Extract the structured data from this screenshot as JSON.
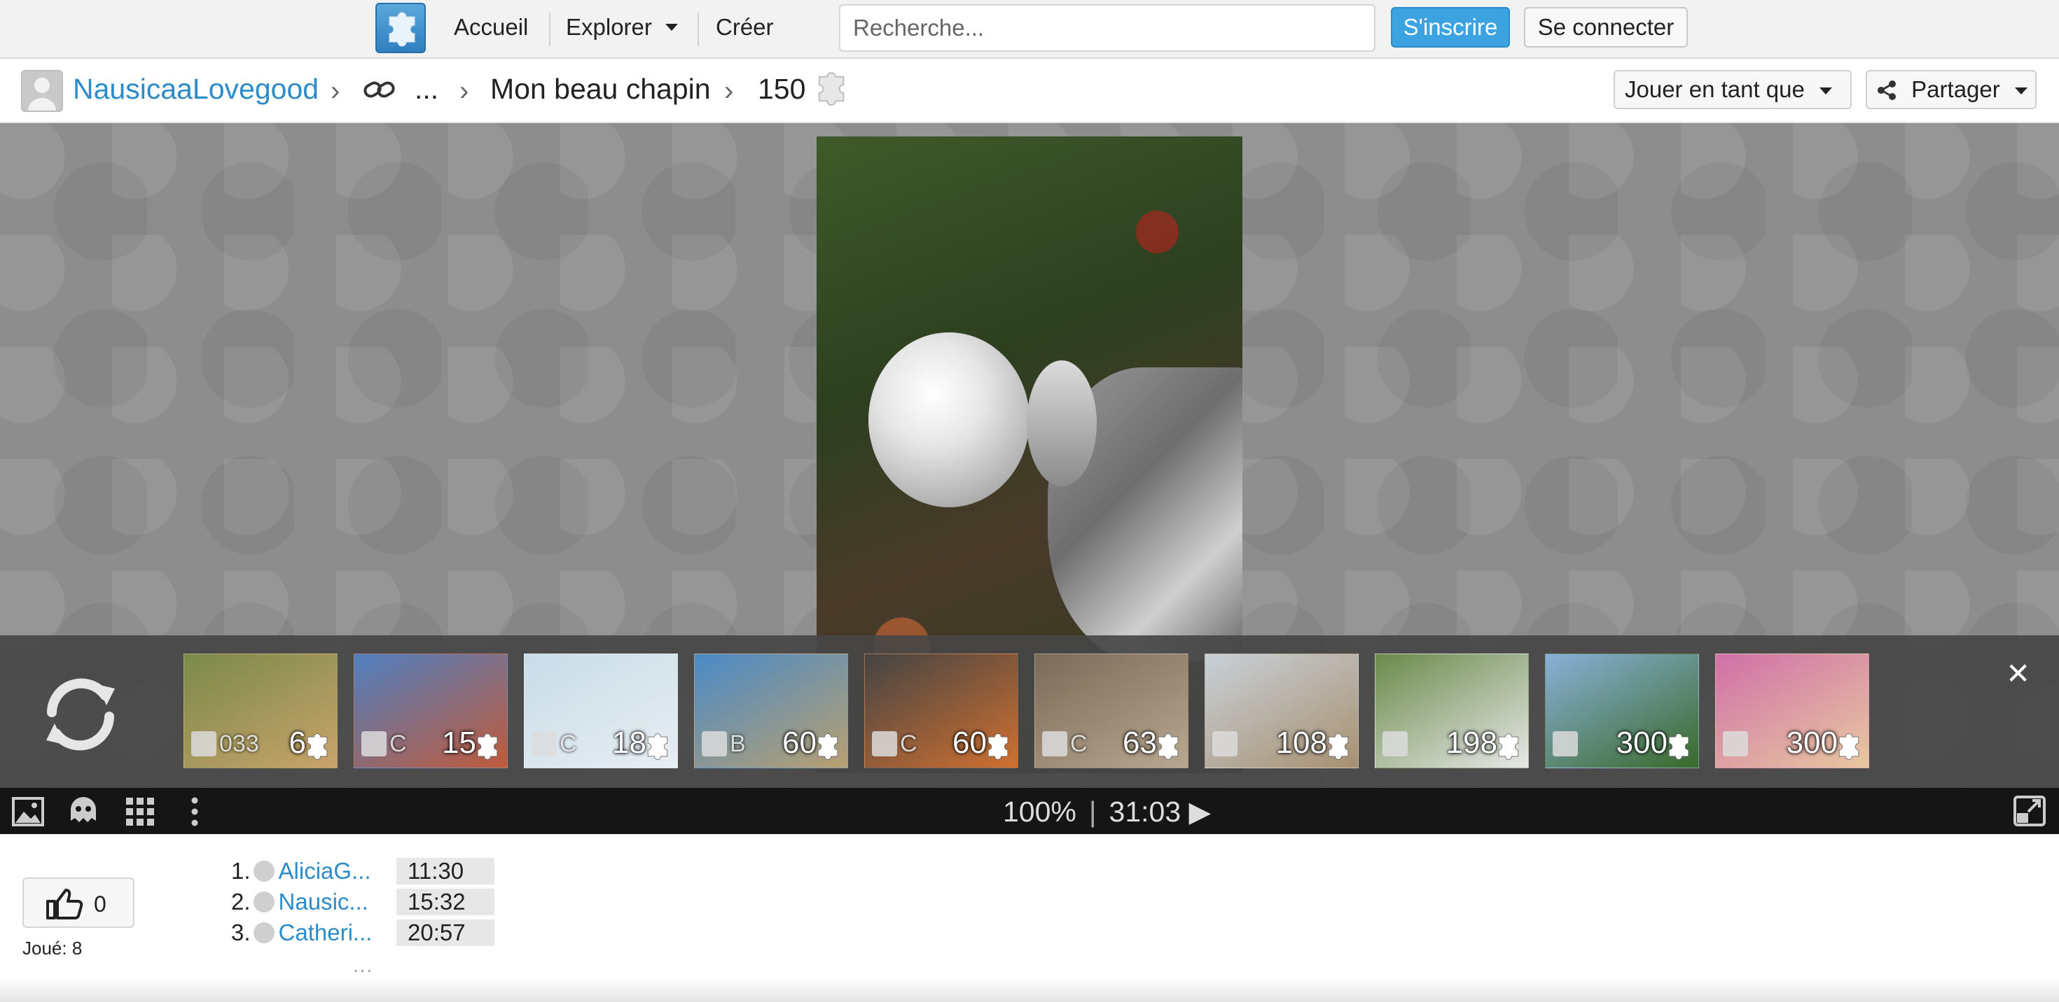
{
  "header": {
    "nav": {
      "home": "Accueil",
      "explore": "Explorer",
      "create": "Créer"
    },
    "search": {
      "placeholder": "Recherche..."
    },
    "signup": "S'inscrire",
    "signin": "Se connecter"
  },
  "breadcrumb": {
    "user": "NausicaaLovegood",
    "ellipsis": "...",
    "album": "Mon beau chapin",
    "pieces": "150"
  },
  "actions": {
    "play_as": "Jouer en tant que",
    "share": "Partager"
  },
  "strip": {
    "thumbs": [
      {
        "count": "6",
        "overlay": "033",
        "colors": [
          "#7a8a4a",
          "#c9a36a"
        ]
      },
      {
        "count": "15",
        "overlay": "C",
        "colors": [
          "#4f7fc0",
          "#c05a3a"
        ]
      },
      {
        "count": "18",
        "overlay": "C",
        "colors": [
          "#c8dce8",
          "#e8eef2"
        ]
      },
      {
        "count": "60",
        "overlay": "B",
        "colors": [
          "#4a8ac8",
          "#b8a070"
        ]
      },
      {
        "count": "60",
        "overlay": "C",
        "colors": [
          "#444444",
          "#d07030"
        ]
      },
      {
        "count": "63",
        "overlay": "C",
        "colors": [
          "#7a6a58",
          "#b8a890"
        ]
      },
      {
        "count": "108",
        "overlay": "",
        "colors": [
          "#c8d0d8",
          "#a89070"
        ]
      },
      {
        "count": "198",
        "overlay": "",
        "colors": [
          "#6a8a4a",
          "#e8e8e8"
        ]
      },
      {
        "count": "300",
        "overlay": "",
        "colors": [
          "#8ab0d8",
          "#3a6a2a"
        ]
      },
      {
        "count": "300",
        "overlay": "",
        "colors": [
          "#d070a8",
          "#e8c8a0"
        ]
      }
    ]
  },
  "toolbar": {
    "zoom": "100%",
    "divider": "|",
    "timer": "31:03 ▶"
  },
  "like": {
    "count": "0"
  },
  "played": "Joué: 8",
  "leaderboard": [
    {
      "rank": "1.",
      "name": "AliciaG...",
      "time": "11:30"
    },
    {
      "rank": "2.",
      "name": "Nausic...",
      "time": "15:32"
    },
    {
      "rank": "3.",
      "name": "Catheri...",
      "time": "20:57"
    }
  ],
  "leaderboard_more": "...",
  "icons": {
    "logo": "puzzle-logo-icon",
    "refresh": "refresh-icon",
    "close": "close-icon",
    "image": "image-icon",
    "ghost": "ghost-icon",
    "grid": "grid-icon",
    "more": "more-vertical-icon",
    "fullscreen": "fullscreen-icon",
    "thumbs_up": "thumbs-up-icon",
    "link": "link-icon",
    "share": "share-icon"
  },
  "colors": {
    "accent": "#3ca3e0",
    "link": "#2b8cc8",
    "toolbar": "#151515"
  }
}
